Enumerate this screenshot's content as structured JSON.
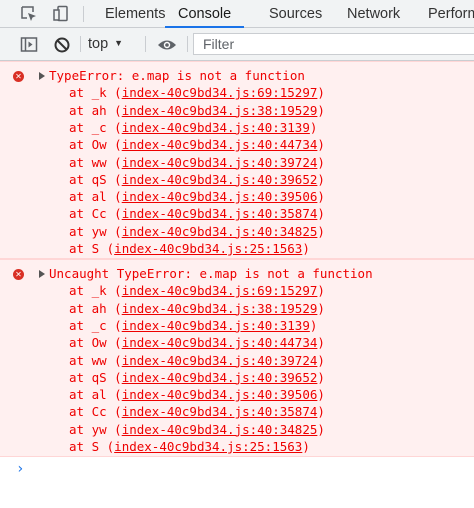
{
  "tabs": [
    "Elements",
    "Console",
    "Sources",
    "Network",
    "Perform"
  ],
  "active_tab": "Console",
  "toolbar": {
    "context": "top",
    "filter_placeholder": "Filter"
  },
  "messages": [
    {
      "text": "TypeError: e.map is not a function",
      "stack": [
        {
          "fn": "_k",
          "src": "index-40c9bd34.js:69:15297"
        },
        {
          "fn": "ah",
          "src": "index-40c9bd34.js:38:19529"
        },
        {
          "fn": "_c",
          "src": "index-40c9bd34.js:40:3139"
        },
        {
          "fn": "Ow",
          "src": "index-40c9bd34.js:40:44734"
        },
        {
          "fn": "ww",
          "src": "index-40c9bd34.js:40:39724"
        },
        {
          "fn": "qS",
          "src": "index-40c9bd34.js:40:39652"
        },
        {
          "fn": "al",
          "src": "index-40c9bd34.js:40:39506"
        },
        {
          "fn": "Cc",
          "src": "index-40c9bd34.js:40:35874"
        },
        {
          "fn": "yw",
          "src": "index-40c9bd34.js:40:34825"
        },
        {
          "fn": "S",
          "src": "index-40c9bd34.js:25:1563"
        }
      ]
    },
    {
      "text": "Uncaught TypeError: e.map is not a function",
      "stack": [
        {
          "fn": "_k",
          "src": "index-40c9bd34.js:69:15297"
        },
        {
          "fn": "ah",
          "src": "index-40c9bd34.js:38:19529"
        },
        {
          "fn": "_c",
          "src": "index-40c9bd34.js:40:3139"
        },
        {
          "fn": "Ow",
          "src": "index-40c9bd34.js:40:44734"
        },
        {
          "fn": "ww",
          "src": "index-40c9bd34.js:40:39724"
        },
        {
          "fn": "qS",
          "src": "index-40c9bd34.js:40:39652"
        },
        {
          "fn": "al",
          "src": "index-40c9bd34.js:40:39506"
        },
        {
          "fn": "Cc",
          "src": "index-40c9bd34.js:40:35874"
        },
        {
          "fn": "yw",
          "src": "index-40c9bd34.js:40:34825"
        },
        {
          "fn": "S",
          "src": "index-40c9bd34.js:25:1563"
        }
      ]
    }
  ],
  "prompt_symbol": "›",
  "colors": {
    "error_text": "#ee0000",
    "error_bg": "#fff0f0",
    "accent": "#1a73e8"
  },
  "icons": [
    "inspect-element-icon",
    "device-toolbar-icon",
    "sidebar-toggle-icon",
    "clear-console-icon",
    "dropdown-arrow-icon",
    "eye-icon",
    "error-icon",
    "expand-triangle-icon"
  ]
}
